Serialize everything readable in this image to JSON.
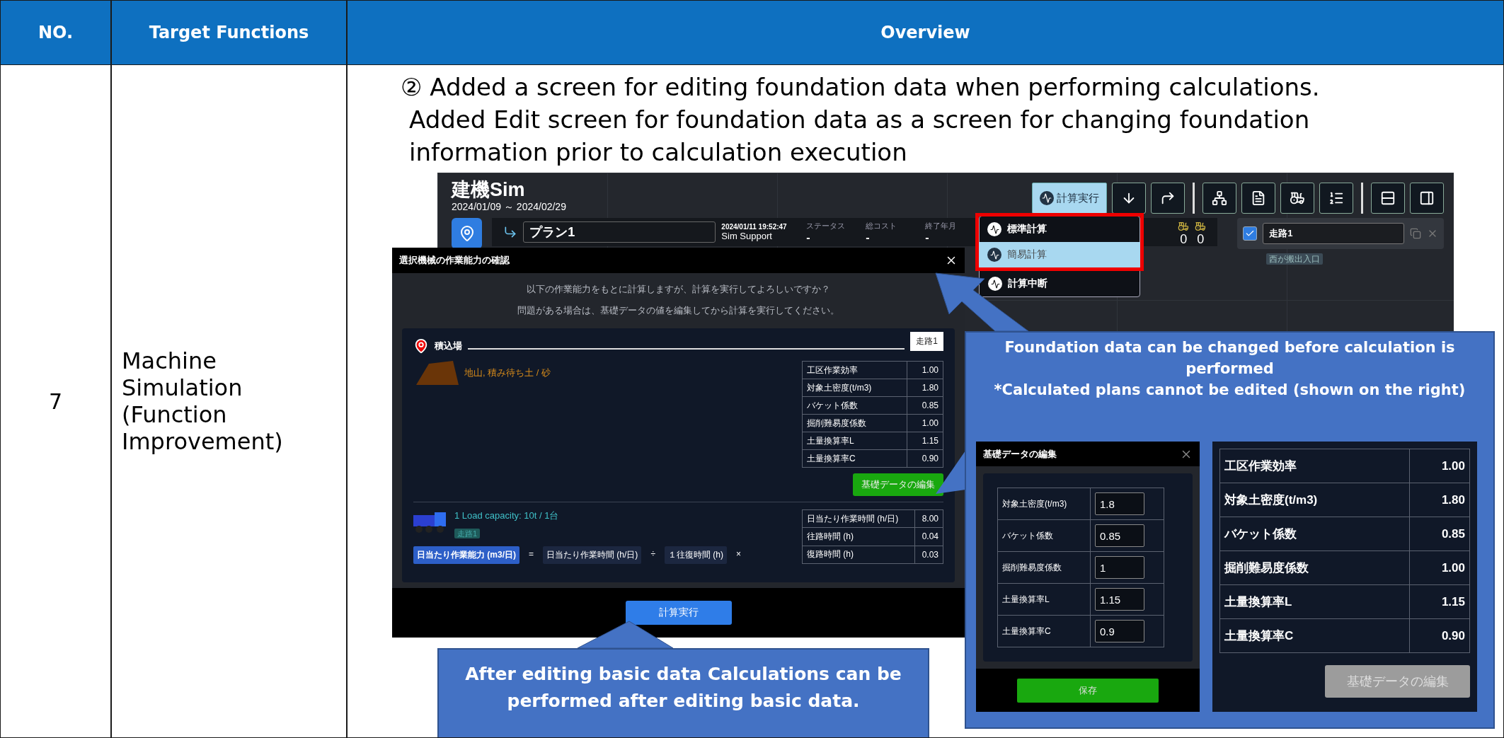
{
  "table": {
    "columns": [
      "NO.",
      "Target Functions",
      "Overview"
    ],
    "row": {
      "no": "7",
      "target": "Machine Simulation (Function Improvement)",
      "overview_lines": [
        "② Added a screen for editing foundation data when performing calculations.",
        "Added Edit screen for foundation data as a screen for changing foundation information prior to calculation execution"
      ]
    }
  },
  "app": {
    "title": "建機Sim",
    "period": "2024/01/09 ～ 2024/02/29",
    "toolbar_button": "計算実行",
    "plan": {
      "name": "プラン1",
      "timestamp": "2024/01/11 19:52:47",
      "user": "Sim Support",
      "stats": [
        {
          "label": "ステータス",
          "value": "-"
        },
        {
          "label": "総コスト",
          "value": "-"
        },
        {
          "label": "終了年月",
          "value": "-"
        }
      ]
    },
    "counts": [
      "0",
      "0"
    ],
    "route": {
      "checked": true,
      "name": "走路1",
      "tag": "西が搬出入口"
    },
    "menu": [
      {
        "label": "標準計算",
        "selected": false,
        "framed": true
      },
      {
        "label": "簡易計算",
        "selected": true,
        "framed": true
      },
      {
        "label": "計算中断",
        "selected": false,
        "framed": false
      }
    ]
  },
  "dialog": {
    "title": "選択機械の作業能力の確認",
    "message": [
      "以下の作業能力をもとに計算しますが、計算を実行してよろしいですか？",
      "問題がある場合は、基礎データの値を編集してから計算を実行してください。"
    ],
    "section": "積込場",
    "route_tag": "走路1",
    "soil": "地山, 積み待ち土 / 砂",
    "params": [
      {
        "label": "工区作業効率",
        "value": "1.00"
      },
      {
        "label": "対象土密度(t/m3)",
        "value": "1.80"
      },
      {
        "label": "バケット係数",
        "value": "0.85"
      },
      {
        "label": "掘削難易度係数",
        "value": "1.00"
      },
      {
        "label": "土量換算率L",
        "value": "1.15"
      },
      {
        "label": "土量換算率C",
        "value": "0.90"
      }
    ],
    "edit_button": "基礎データの編集",
    "truck": {
      "title": "1   Load capacity: 10t / 1台",
      "tag": "走路1",
      "formula": [
        {
          "kind": "result",
          "text": "日当たり作業能力 (m3/日)"
        },
        {
          "kind": "op",
          "text": "="
        },
        {
          "kind": "term",
          "text": "日当たり作業時間 (h/日)"
        },
        {
          "kind": "op",
          "text": "÷"
        },
        {
          "kind": "term",
          "text": "１往復時間 (h)"
        },
        {
          "kind": "op",
          "text": "×"
        }
      ],
      "params": [
        {
          "label": "日当たり作業時間 (h/日)",
          "value": "8.00"
        },
        {
          "label": "往路時間 (h)",
          "value": "0.04"
        },
        {
          "label": "復路時間 (h)",
          "value": "0.03"
        }
      ]
    },
    "run_button": "計算実行"
  },
  "callout_right": {
    "lines": [
      "Foundation data can be changed before calculation is performed",
      "*Calculated plans cannot be edited (shown on the right)"
    ],
    "edit_dialog": {
      "title": "基礎データの編集",
      "fields": [
        {
          "label": "対象土密度(t/m3)",
          "value": "1.8"
        },
        {
          "label": "バケット係数",
          "value": "0.85"
        },
        {
          "label": "掘削難易度係数",
          "value": "1"
        },
        {
          "label": "土量換算率L",
          "value": "1.15"
        },
        {
          "label": "土量換算率C",
          "value": "0.9"
        }
      ],
      "save": "保存"
    },
    "readonly": {
      "params": [
        {
          "label": "工区作業効率",
          "value": "1.00"
        },
        {
          "label": "対象土密度(t/m3)",
          "value": "1.80"
        },
        {
          "label": "バケット係数",
          "value": "0.85"
        },
        {
          "label": "掘削難易度係数",
          "value": "1.00"
        },
        {
          "label": "土量換算率L",
          "value": "1.15"
        },
        {
          "label": "土量換算率C",
          "value": "0.90"
        }
      ],
      "button": {
        "label": "基礎データの編集",
        "disabled": true
      }
    }
  },
  "callout_bottom": "After editing basic data Calculations can be performed after editing basic data."
}
